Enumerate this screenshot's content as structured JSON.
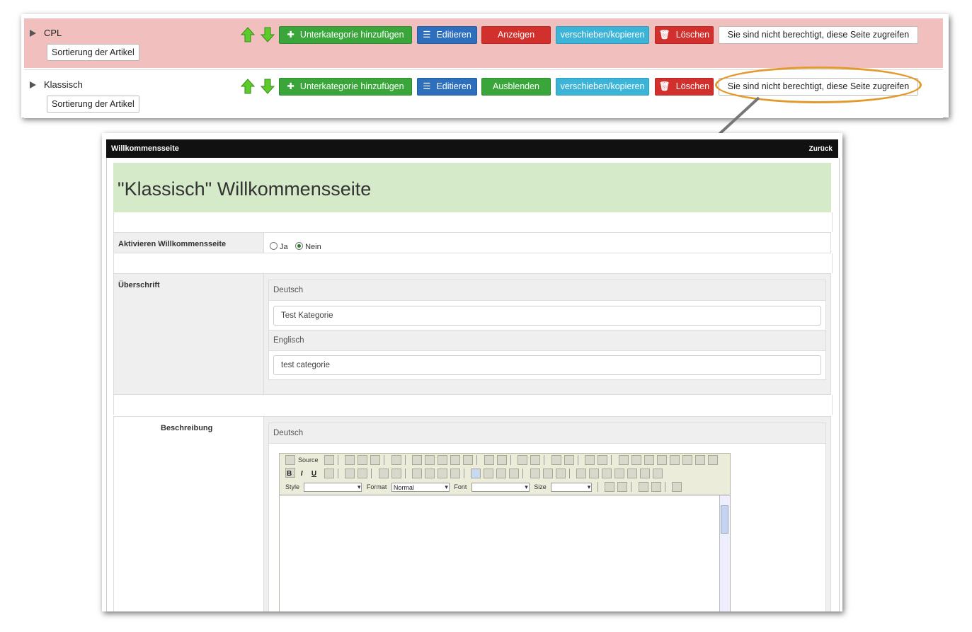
{
  "categories": [
    {
      "name": "CPL",
      "sort_label": "Sortierung der Artikel",
      "add_sub": "Unterkategorie hinzufügen",
      "edit": "Editieren",
      "toggle": "Anzeigen",
      "move": "verschieben/kopieren",
      "delete": "Löschen",
      "no_access": "Sie sind nicht berechtigt, diese Seite zugreifen",
      "row_color": "#f2bfbf",
      "toggle_color": "#d2302c"
    },
    {
      "name": "Klassisch",
      "sort_label": "Sortierung der Artikel",
      "add_sub": "Unterkategorie hinzufügen",
      "edit": "Editieren",
      "toggle": "Ausblenden",
      "move": "verschieben/kopieren",
      "delete": "Löschen",
      "no_access": "Sie sind nicht berechtigt, diese Seite zugreifen",
      "row_color": "#ffffff",
      "toggle_color": "#3aa53a"
    }
  ],
  "welcome": {
    "bar_title": "Willkommensseite",
    "back": "Zurück",
    "heading": "\"Klassisch\" Willkommensseite",
    "activate_label": "Aktivieren Willkommensseite",
    "radio_yes": "Ja",
    "radio_no": "Nein",
    "radio_selected": "Nein",
    "heading_label": "Überschrift",
    "lang_de": "Deutsch",
    "lang_en": "Englisch",
    "heading_de": "Test Kategorie",
    "heading_en": "test categorie",
    "desc_label": "Beschreibung",
    "desc_lang": "Deutsch"
  },
  "editor": {
    "source": "Source",
    "style_label": "Style",
    "format_label": "Format",
    "format_value": "Normal",
    "font_label": "Font",
    "size_label": "Size"
  },
  "colors": {
    "accent_callout": "#e39a2d",
    "green": "#3aa53a",
    "blue": "#2d6ebd",
    "red": "#d2302c",
    "cyan": "#3bb4d8",
    "header_bg": "#d4eac8"
  }
}
